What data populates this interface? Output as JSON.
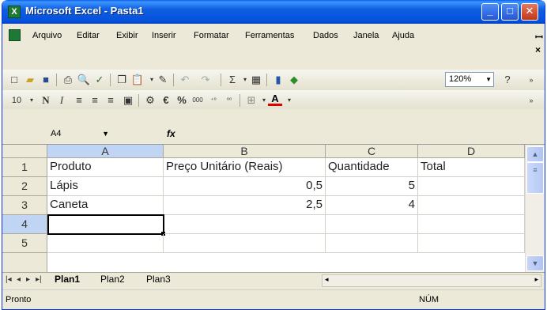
{
  "window": {
    "title": "Microsoft Excel - Pasta1",
    "app_icon": "excel-icon"
  },
  "menu": {
    "items": [
      {
        "label": "Arquivo"
      },
      {
        "label": "Editar"
      },
      {
        "label": "Exibir"
      },
      {
        "label": "Inserir"
      },
      {
        "label": "Formatar"
      },
      {
        "label": "Ferramentas"
      },
      {
        "label": "Dados"
      },
      {
        "label": "Janela"
      },
      {
        "label": "Ajuda"
      }
    ]
  },
  "toolbar": {
    "zoom": "120%",
    "font_size": "10"
  },
  "formula_bar": {
    "name_box": "A4",
    "fx_label": "fx",
    "content": ""
  },
  "sheet": {
    "columns": [
      "A",
      "B",
      "C",
      "D"
    ],
    "rows": [
      "1",
      "2",
      "3",
      "4",
      "5"
    ],
    "cells": [
      [
        "Produto",
        "Preço Unitário (Reais)",
        "Quantidade",
        "Total"
      ],
      [
        "Lápis",
        "0,5",
        "5",
        ""
      ],
      [
        "Caneta",
        "2,5",
        "4",
        ""
      ],
      [
        "",
        "",
        "",
        ""
      ],
      [
        "",
        "",
        "",
        ""
      ]
    ],
    "active_cell": "A4"
  },
  "sheet_tabs": [
    "Plan1",
    "Plan2",
    "Plan3"
  ],
  "status": {
    "left": "Pronto",
    "num": "NÚM"
  },
  "colors": {
    "title_bar": "#0553dd",
    "selected_header": "#c0d5f3",
    "window_bg": "#ece9d8"
  }
}
